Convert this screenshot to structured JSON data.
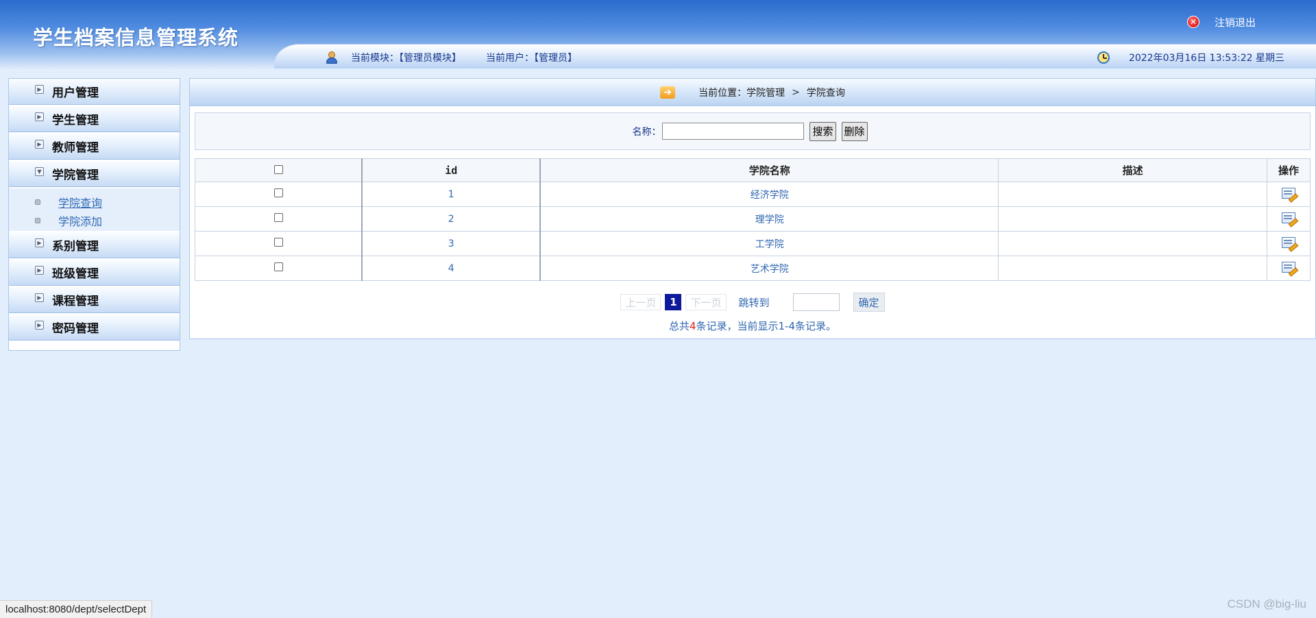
{
  "header": {
    "title": "学生档案信息管理系统",
    "logout_label": "注销退出",
    "module_text": "当前模块：【管理员模块】",
    "user_text": "当前用户：【管理员】",
    "datetime": "2022年03月16日 13:53:22 星期三"
  },
  "sidebar": {
    "items": [
      {
        "label": "用户管理"
      },
      {
        "label": "学生管理"
      },
      {
        "label": "教师管理"
      },
      {
        "label": "学院管理",
        "expanded": true,
        "children": [
          {
            "label": "学院查询",
            "active": true
          },
          {
            "label": "学院添加"
          }
        ]
      },
      {
        "label": "系别管理"
      },
      {
        "label": "班级管理"
      },
      {
        "label": "课程管理"
      },
      {
        "label": "密码管理"
      }
    ]
  },
  "breadcrumb": {
    "prefix": "当前位置：学院管理",
    "separator": ">",
    "current": "学院查询"
  },
  "search": {
    "label": "名称：",
    "value": "",
    "search_button": "搜索",
    "delete_button": "删除"
  },
  "table": {
    "headers": [
      "id",
      "学院名称",
      "描述",
      "操作"
    ],
    "rows": [
      {
        "id": "1",
        "name": "经济学院",
        "desc": ""
      },
      {
        "id": "2",
        "name": "理学院",
        "desc": ""
      },
      {
        "id": "3",
        "name": "工学院",
        "desc": ""
      },
      {
        "id": "4",
        "name": "艺术学院",
        "desc": ""
      }
    ]
  },
  "pager": {
    "prev": "上一页",
    "current": "1",
    "next": "下一页",
    "jump_label": "跳转到",
    "jump_value": "",
    "ok_button": "确定",
    "summary_prefix": "总共",
    "summary_count": "4",
    "summary_suffix": "条记录，当前显示1-4条记录。"
  },
  "statusbar": {
    "url": "localhost:8080/dept/selectDept"
  },
  "watermark": "CSDN @big-liu",
  "colors": {
    "accent": "#2a6ccc",
    "link": "#2f66b0",
    "page_bg": "#e2eefb",
    "current_page": "#0d1a9a"
  }
}
